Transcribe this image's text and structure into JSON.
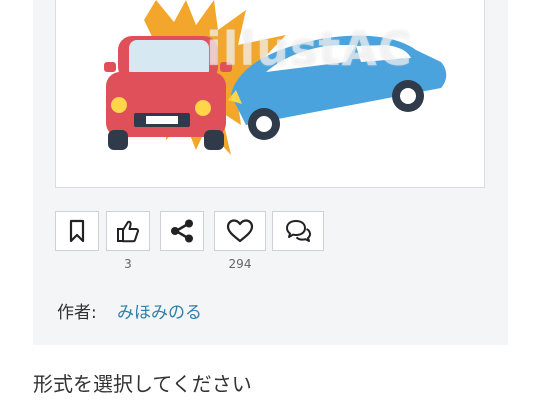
{
  "watermark": "illustAC",
  "actions": {
    "bookmark": {
      "icon": "bookmark-icon"
    },
    "like": {
      "icon": "thumbs-up-icon",
      "count": "3"
    },
    "share": {
      "icon": "share-icon"
    },
    "favorite": {
      "icon": "heart-icon",
      "count": "294"
    },
    "comment": {
      "icon": "comments-icon"
    }
  },
  "author": {
    "label": "作者:",
    "name": "みほみのる"
  },
  "section_title": "形式を選択してください",
  "colors": {
    "red_car": "#e0505a",
    "blue_car": "#4aa3dc",
    "burst": "#f2a62c",
    "link": "#2f7fa8",
    "panel_bg": "#f4f5f7"
  }
}
